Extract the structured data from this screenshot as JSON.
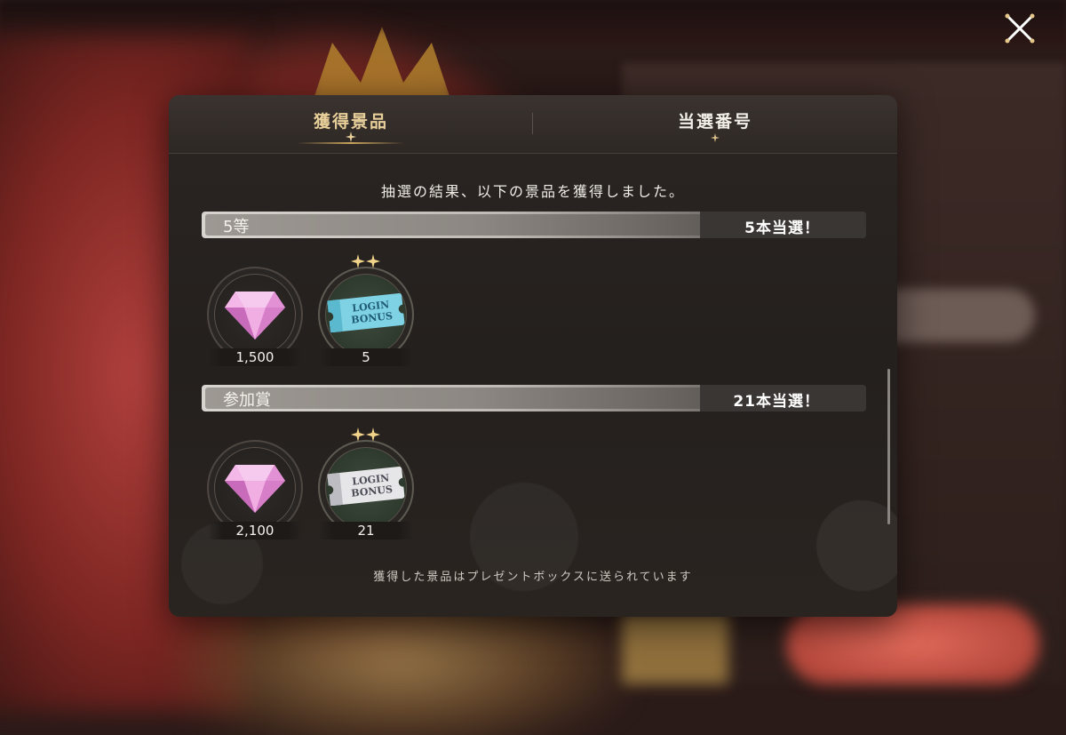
{
  "tabs": [
    {
      "label": "獲得景品",
      "active": true
    },
    {
      "label": "当選番号",
      "active": false
    }
  ],
  "intro_text": "抽選の結果、以下の景品を獲得しました。",
  "tiers": [
    {
      "name": "5等",
      "count": "5本当選！",
      "items": [
        {
          "icon": "gem-icon",
          "quantity": "1,500"
        },
        {
          "icon": "login-bonus-ticket-blue-icon",
          "ticket_text": "LOGIN BONUS",
          "quantity": "5"
        }
      ]
    },
    {
      "name": "参加賞",
      "count": "21本当選！",
      "items": [
        {
          "icon": "gem-icon",
          "quantity": "2,100"
        },
        {
          "icon": "login-bonus-ticket-silver-icon",
          "ticket_text": "LOGIN BONUS",
          "quantity": "21"
        }
      ]
    }
  ],
  "footer_note": "獲得した景品はプレゼントボックスに送られています",
  "colors": {
    "tab_active": "#e8cf9a",
    "accent_gold": "#c9a35c"
  }
}
